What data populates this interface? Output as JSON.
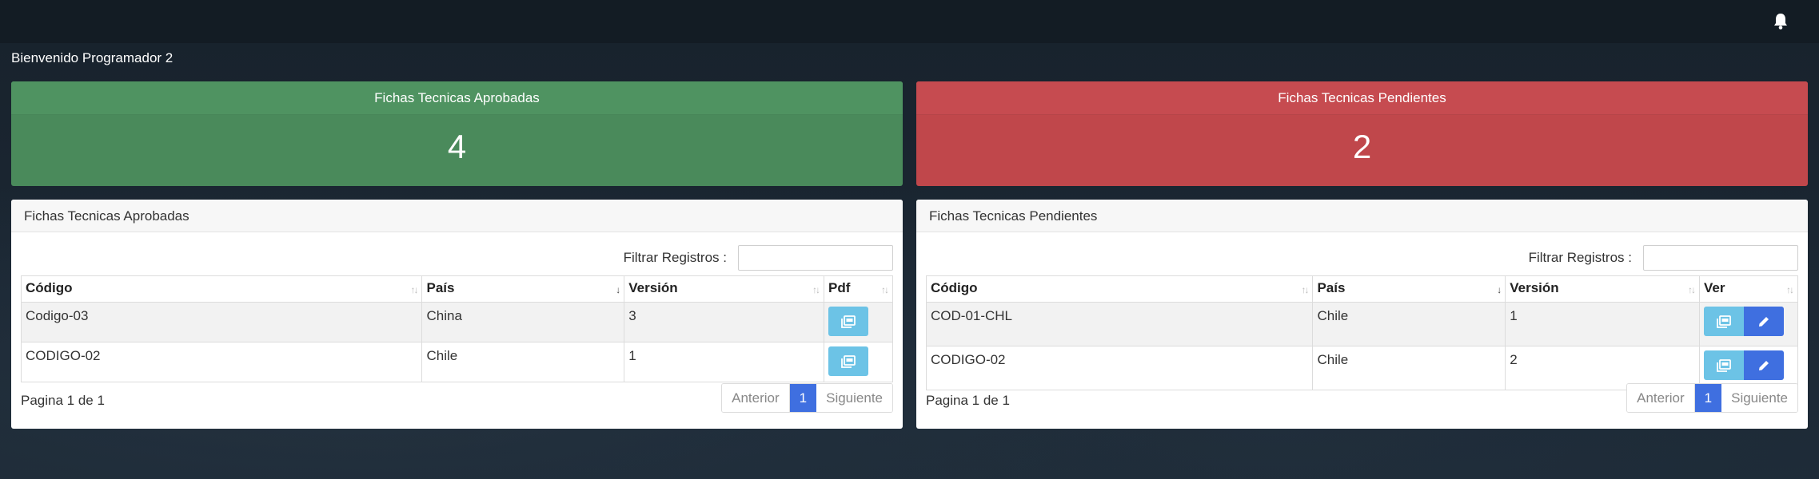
{
  "header": {
    "notification_icon": "bell-icon"
  },
  "welcome": "Bienvenido Programador 2",
  "stats": {
    "approved": {
      "title": "Fichas Tecnicas Aprobadas",
      "count": "4",
      "color": "#4f9361"
    },
    "pending": {
      "title": "Fichas Tecnicas Pendientes",
      "count": "2",
      "color": "#c64b50"
    }
  },
  "approved_table": {
    "title": "Fichas Tecnicas Aprobadas",
    "filter_label": "Filtrar Registros :",
    "filter_value": "",
    "columns": [
      "Código",
      "País",
      "Versión",
      "Pdf"
    ],
    "rows": [
      {
        "codigo": "Codigo-03",
        "pais": "China",
        "version": "3",
        "action_icon": "pdf-icon"
      },
      {
        "codigo": "CODIGO-02",
        "pais": "Chile",
        "version": "1",
        "action_icon": "pdf-icon"
      }
    ],
    "page_info": "Pagina 1 de 1",
    "pager": {
      "prev": "Anterior",
      "current": "1",
      "next": "Siguiente"
    }
  },
  "pending_table": {
    "title": "Fichas Tecnicas Pendientes",
    "filter_label": "Filtrar Registros :",
    "filter_value": "",
    "columns": [
      "Código",
      "País",
      "Versión",
      "Ver"
    ],
    "rows": [
      {
        "codigo": "COD-01-CHL",
        "pais": "Chile",
        "version": "1",
        "action_icons": [
          "pdf-icon",
          "edit-pencil-icon"
        ]
      },
      {
        "codigo": "CODIGO-02",
        "pais": "Chile",
        "version": "2",
        "action_icons": [
          "pdf-icon",
          "edit-pencil-icon"
        ]
      }
    ],
    "page_info": "Pagina 1 de 1",
    "pager": {
      "prev": "Anterior",
      "current": "1",
      "next": "Siguiente"
    }
  },
  "colors": {
    "info": "#6cc3e6",
    "primary": "#3f6fe0",
    "topbar": "#131c24"
  }
}
